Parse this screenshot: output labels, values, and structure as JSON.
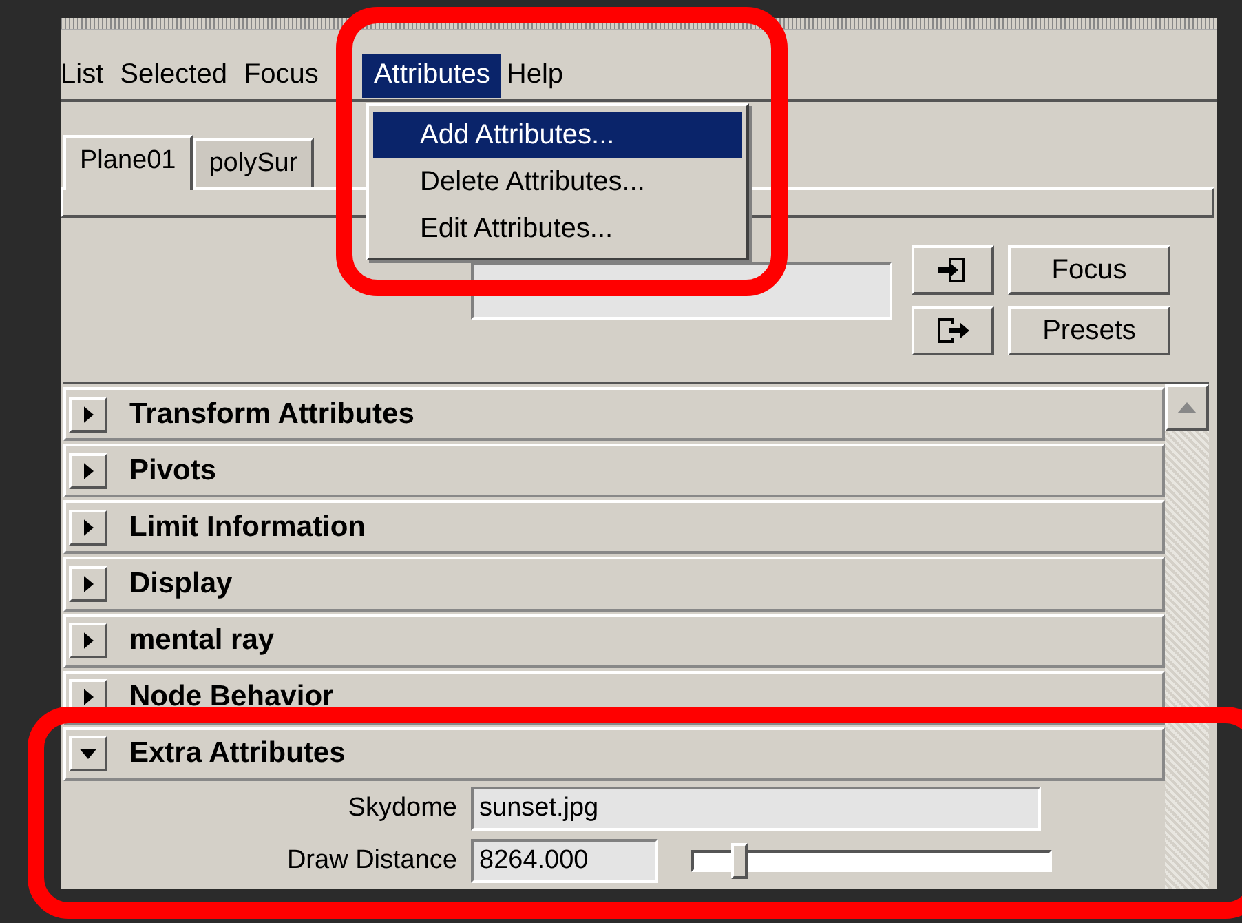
{
  "menu_bar": [
    {
      "label": "List",
      "selected": false
    },
    {
      "label": "Selected",
      "selected": false
    },
    {
      "label": "Focus",
      "selected": false
    },
    {
      "label": "Attributes",
      "selected": true
    },
    {
      "label": "Help",
      "selected": false
    }
  ],
  "menu": {
    "items": [
      {
        "label": "Add Attributes...",
        "selected": true
      },
      {
        "label": "Delete Attributes...",
        "selected": false
      },
      {
        "label": "Edit Attributes...",
        "selected": false
      }
    ]
  },
  "tabs": [
    {
      "label": "Plane01",
      "selected": true
    },
    {
      "label": "polySur",
      "selected": false
    }
  ],
  "side_buttons": [
    {
      "kind": "import"
    },
    {
      "kind": "text",
      "label": "Focus"
    },
    {
      "kind": "export"
    },
    {
      "kind": "text",
      "label": "Presets"
    }
  ],
  "sections": [
    {
      "title": "Transform Attributes",
      "expanded": false
    },
    {
      "title": "Pivots",
      "expanded": false
    },
    {
      "title": "Limit Information",
      "expanded": false
    },
    {
      "title": "Display",
      "expanded": false
    },
    {
      "title": "mental ray",
      "expanded": false
    },
    {
      "title": "Node Behavior",
      "expanded": false
    },
    {
      "title": "Extra Attributes",
      "expanded": true,
      "fields": [
        {
          "kind": "text",
          "label": "Skydome",
          "value": "sunset.jpg"
        },
        {
          "kind": "slider",
          "label": "Draw Distance",
          "value": "8264.000",
          "level": 0.11
        }
      ]
    }
  ]
}
